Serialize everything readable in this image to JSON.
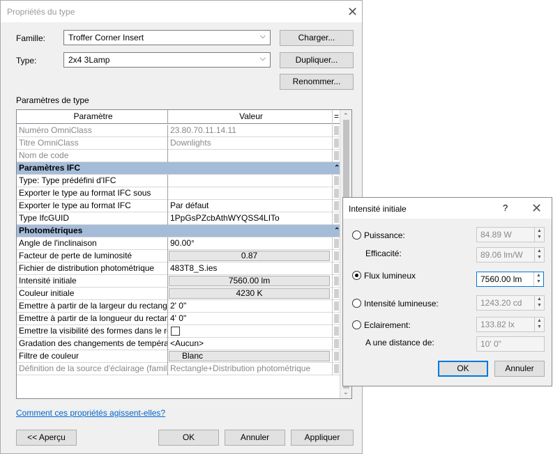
{
  "window": {
    "title": "Propriétés du type",
    "close_glyph": "✕"
  },
  "family": {
    "label": "Famille:",
    "value": "Troffer Corner Insert"
  },
  "type": {
    "label": "Type:",
    "value": "2x4 3Lamp"
  },
  "buttons": {
    "load": "Charger...",
    "duplicate": "Dupliquer...",
    "rename": "Renommer..."
  },
  "params_label": "Paramètres de type",
  "table": {
    "header_param": "Paramètre",
    "header_value": "Valeur",
    "header_equals": "=",
    "rows": [
      {
        "kind": "row",
        "param": "Numéro OmniClass",
        "value": "23.80.70.11.14.11",
        "grey": true
      },
      {
        "kind": "row",
        "param": "Titre OmniClass",
        "value": "Downlights",
        "grey": true
      },
      {
        "kind": "row",
        "param": "Nom de code",
        "value": "",
        "grey": true
      },
      {
        "kind": "group",
        "param": "Paramètres IFC",
        "collapse": "⌃"
      },
      {
        "kind": "row",
        "param": "Type: Type prédéfini d'IFC",
        "value": ""
      },
      {
        "kind": "row",
        "param": "Exporter le type au format IFC sous",
        "value": ""
      },
      {
        "kind": "row",
        "param": "Exporter le type au format IFC",
        "value": "Par défaut"
      },
      {
        "kind": "row",
        "param": "Type IfcGUID",
        "value": "1PpGsPZcbAthWYQSS4LITo"
      },
      {
        "kind": "group",
        "param": "Photométriques",
        "collapse": "⌃"
      },
      {
        "kind": "row",
        "param": "Angle de l'inclinaison",
        "value": "90.00°"
      },
      {
        "kind": "btnrow",
        "param": "Facteur de perte de luminosité",
        "value": "0.87"
      },
      {
        "kind": "row",
        "param": "Fichier de distribution photométrique",
        "value": "483T8_S.ies"
      },
      {
        "kind": "btnrow",
        "param": "Intensité initiale",
        "value": "7560.00 lm"
      },
      {
        "kind": "btnrow",
        "param": "Couleur initiale",
        "value": "4230 K"
      },
      {
        "kind": "row",
        "param": "Emettre à partir de la largeur du rectangle",
        "value": "2'  0\""
      },
      {
        "kind": "row",
        "param": "Emettre à partir de la longueur du rectangle",
        "value": "4'  0\""
      },
      {
        "kind": "check",
        "param": "Emettre la visibilité des formes dans le rendu",
        "value": ""
      },
      {
        "kind": "row",
        "param": "Gradation des changements de température",
        "value": "<Aucun>"
      },
      {
        "kind": "btnrow",
        "param": "Filtre de couleur",
        "value": "Blanc",
        "left": true
      },
      {
        "kind": "row",
        "param": "Définition de la source d'éclairage (famille)",
        "value": "Rectangle+Distribution photométrique",
        "grey": true
      }
    ]
  },
  "help_link": "Comment ces propriétés agissent-elles?",
  "footer": {
    "preview": "<< Aperçu",
    "ok": "OK",
    "cancel": "Annuler",
    "apply": "Appliquer"
  },
  "dialog": {
    "title": "Intensité initiale",
    "help": "?",
    "close": "✕",
    "power_label": "Puissance:",
    "power_value": "84.89 W",
    "efficacy_label": "Efficacité:",
    "efficacy_value": "89.06 lm/W",
    "flux_label": "Flux lumineux",
    "flux_value": "7560.00 lm",
    "intensity_label": "Intensité lumineuse:",
    "intensity_value": "1243.20 cd",
    "illum_label": "Eclairement:",
    "illum_value": "133.82 lx",
    "distance_label": "A une distance de:",
    "distance_value": "10'  0\"",
    "ok": "OK",
    "cancel": "Annuler"
  },
  "colors": {
    "group_band": "#a5bcd9",
    "accent": "#0078d7",
    "link": "#0066cc"
  }
}
